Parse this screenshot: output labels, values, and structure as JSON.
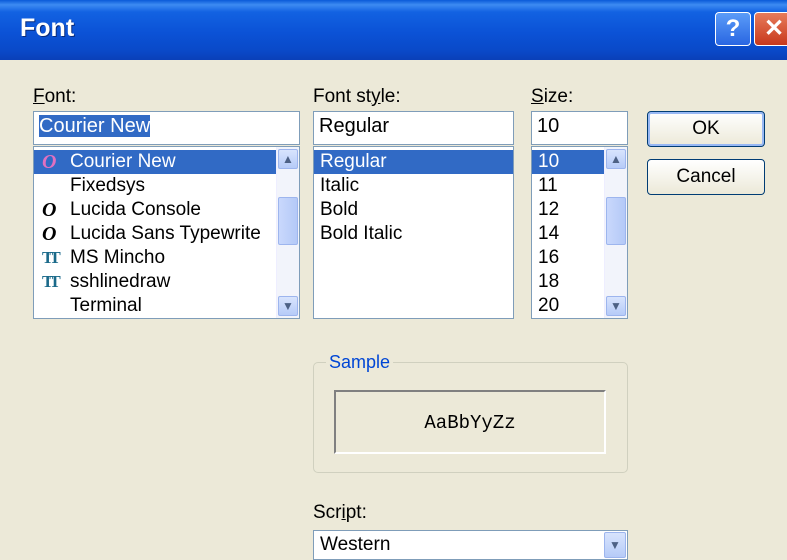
{
  "window": {
    "title": "Font",
    "help_glyph": "?",
    "close_glyph": "✕"
  },
  "labels": {
    "font_u": "F",
    "font_rest": "ont:",
    "style_a": "Font st",
    "style_u": "y",
    "style_b": "le:",
    "size_u": "S",
    "size_rest": "ize:",
    "sample": "Sample",
    "script_a": "Scr",
    "script_u": "i",
    "script_b": "pt:"
  },
  "font": {
    "value": "Courier New",
    "items": [
      {
        "label": "Courier New",
        "icon": "O"
      },
      {
        "label": "Fixedsys",
        "icon": ""
      },
      {
        "label": "Lucida Console",
        "icon": "O"
      },
      {
        "label": "Lucida Sans Typewrite",
        "icon": "O"
      },
      {
        "label": "MS Mincho",
        "icon": "TT"
      },
      {
        "label": "sshlinedraw",
        "icon": "TT"
      },
      {
        "label": "Terminal",
        "icon": ""
      }
    ]
  },
  "style": {
    "value": "Regular",
    "items": [
      "Regular",
      "Italic",
      "Bold",
      "Bold Italic"
    ]
  },
  "size": {
    "value": "10",
    "items": [
      "10",
      "11",
      "12",
      "14",
      "16",
      "18",
      "20"
    ]
  },
  "buttons": {
    "ok": "OK",
    "cancel": "Cancel"
  },
  "sample_text": "AaBbYyZz",
  "script": {
    "value": "Western"
  },
  "icons": {
    "scroll_up": "up-arrow-icon",
    "scroll_down": "down-arrow-icon"
  }
}
